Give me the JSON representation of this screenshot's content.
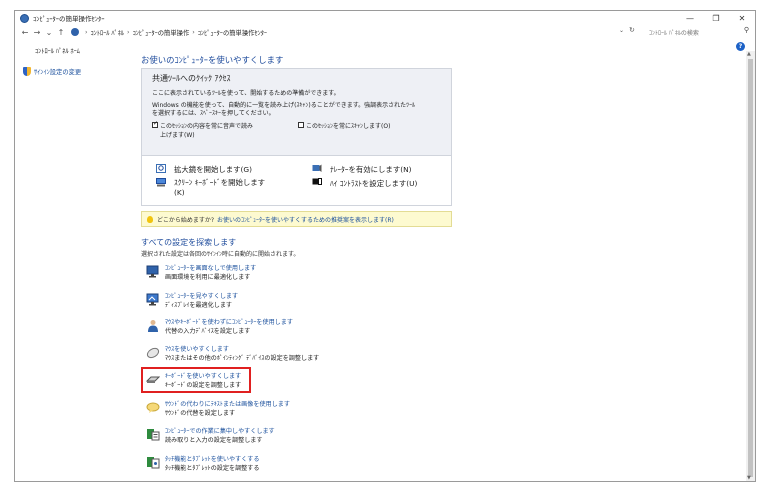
{
  "window": {
    "title": "ｺﾝﾋﾟｭｰﾀｰの簡単操作ｾﾝﾀｰ",
    "minimize": "—",
    "maximize": "❐",
    "close": "✕"
  },
  "address": {
    "back": "←",
    "forward": "→",
    "recent": "⌄",
    "up": "↑",
    "crumbs": [
      "ｺﾝﾄﾛｰﾙ ﾊﾟﾈﾙ",
      "ｺﾝﾋﾟｭｰﾀｰの簡単操作",
      "ｺﾝﾋﾟｭｰﾀｰの簡単操作ｾﾝﾀｰ"
    ],
    "separator": "›",
    "dropdown": "⌄",
    "refresh": "↻",
    "search_placeholder": "ｺﾝﾄﾛｰﾙ ﾊﾟﾈﾙの検索",
    "search_icon": "⚲"
  },
  "sidebar": {
    "home": "ｺﾝﾄﾛｰﾙ ﾊﾟﾈﾙ ﾎｰﾑ",
    "signin": "ｻｲﾝｲﾝ設定の変更"
  },
  "help": "?",
  "scroll": {
    "up": "▲",
    "down": "▼"
  },
  "main": {
    "title": "お使いのｺﾝﾋﾟｭｰﾀｰを使いやすくします",
    "quick": {
      "heading": "共通ﾂｰﾙへのｸｲｯｸ ｱｸｾｽ",
      "line1": "ここに表示されているﾂｰﾙを使って、開始するための準備ができます。",
      "line2": "Windows の機能を使って、自動的に一覧を読み上げ(ｽｷｬﾝ)ることができます。強調表示されたﾂｰﾙ",
      "line3": "を選択するには、ｽﾍﾟｰｽｷｰを押してください。",
      "cb1_line1": "このｾｯｼｮﾝの内容を常に音声で読み",
      "cb1_line2": "上げます(W)",
      "cb2": "このｾｯｼｮﾝを常にｽｷｬﾝします(O)",
      "magnifier": "拡大鏡を開始します(G)",
      "narrator": "ﾅﾚｰﾀｰを有効にします(N)",
      "osk_line1": "ｽｸﾘｰﾝ ｷｰﾎﾞｰﾄﾞを開始します",
      "osk_line2": "(K)",
      "contrast": "ﾊｲ ｺﾝﾄﾗｽﾄを設定します(U)"
    },
    "hint": {
      "question": "どこから始めますか?",
      "link": "お使いのｺﾝﾋﾟｭｰﾀｰを使いやすくするための推奨案を表示します(R)"
    },
    "explore": {
      "title": "すべての設定を探索します",
      "subtitle": "選択された設定は各回のｻｲﾝｲﾝ時に自動的に開始されます。",
      "items": [
        {
          "link": "ｺﾝﾋﾟｭｰﾀｰを画面なしで使用します",
          "desc": "画面環境を利用に最適化します"
        },
        {
          "link": "ｺﾝﾋﾟｭｰﾀｰを見やすくします",
          "desc": "ﾃﾞｨｽﾌﾟﾚｲを最適化します"
        },
        {
          "link": "ﾏｳｽやｷｰﾎﾞｰﾄﾞを使わずにｺﾝﾋﾟｭｰﾀｰを使用します",
          "desc": "代替の入力ﾃﾞﾊﾞｲｽを設定します"
        },
        {
          "link": "ﾏｳｽを使いやすくします",
          "desc": "ﾏｳｽまたはその他のﾎﾟｲﾝﾃｨﾝｸﾞ ﾃﾞﾊﾞｲｽの設定を調整します"
        },
        {
          "link": "ｷｰﾎﾞｰﾄﾞを使いやすくします",
          "desc": "ｷｰﾎﾞｰﾄﾞの設定を調整します"
        },
        {
          "link": "ｻｳﾝﾄﾞの代わりにﾃｷｽﾄまたは画像を使用します",
          "desc": "ｻｳﾝﾄﾞの代替を設定します"
        },
        {
          "link": "ｺﾝﾋﾟｭｰﾀｰでの作業に集中しやすくします",
          "desc": "読み取りと入力の設定を調整します"
        },
        {
          "link": "ﾀｯﾁ機能とﾀﾌﾞﾚｯﾄを使いやすくする",
          "desc": "ﾀｯﾁ機能とﾀﾌﾞﾚｯﾄの設定を調整する"
        }
      ]
    }
  },
  "colors": {
    "link": "#1a4f9c",
    "highlight": "#e02020",
    "hint_bg": "#fdfad0"
  }
}
